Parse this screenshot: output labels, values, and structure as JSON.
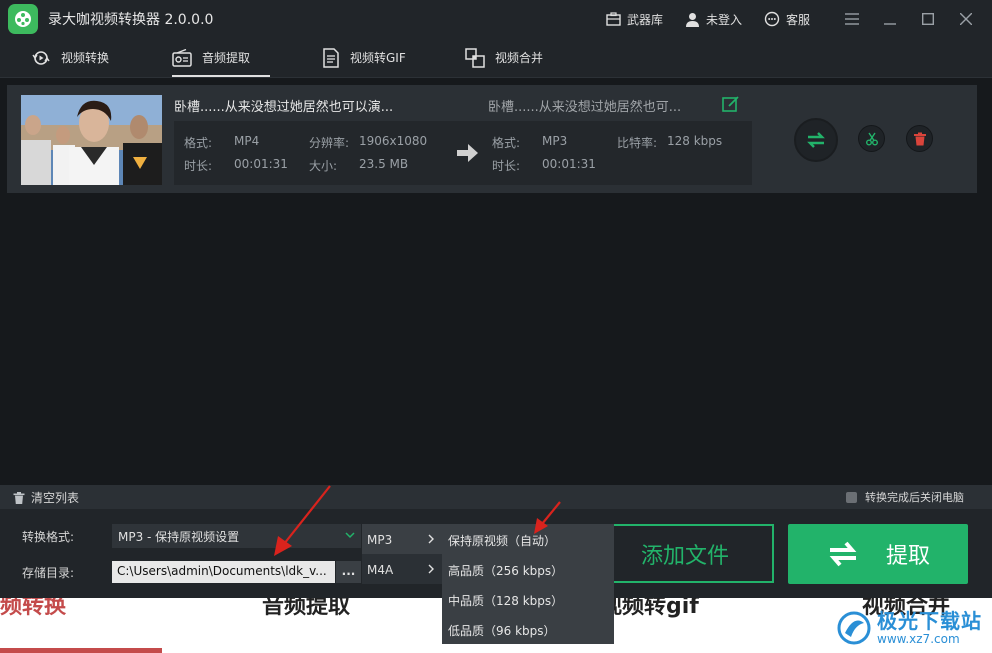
{
  "app": {
    "title": "录大咖视频转换器 2.0.0.0",
    "header_links": [
      {
        "label": "武器库",
        "icon": "toolbox-icon"
      },
      {
        "label": "未登入",
        "icon": "user-icon"
      },
      {
        "label": "客服",
        "icon": "chat-icon"
      }
    ]
  },
  "nav": {
    "tabs": [
      {
        "label": "视频转换",
        "icon": "convert-icon",
        "active": false
      },
      {
        "label": "音频提取",
        "icon": "radio-icon",
        "active": true
      },
      {
        "label": "视频转GIF",
        "icon": "gif-doc-icon",
        "active": false
      },
      {
        "label": "视频合并",
        "icon": "merge-icon",
        "active": false
      }
    ]
  },
  "file": {
    "source_name": "卧槽......从来没想过她居然也可以演...",
    "output_name": "卧槽......从来没想过她居然也可...",
    "source": {
      "format_label": "格式:",
      "format": "MP4",
      "resolution_label": "分辨率:",
      "resolution": "1906x1080",
      "duration_label": "时长:",
      "duration": "00:01:31",
      "size_label": "大小:",
      "size": "23.5 MB"
    },
    "output": {
      "format_label": "格式:",
      "format": "MP3",
      "bitrate_label": "比特率:",
      "bitrate": "128 kbps",
      "duration_label": "时长:",
      "duration": "00:01:31"
    }
  },
  "bottom": {
    "clear_list": "清空列表",
    "shutdown_option": "转换完成后关闭电脑",
    "format_label": "转换格式:",
    "format_value": "MP3 - 保持原视频设置",
    "dir_label": "存储目录:",
    "dir_value": "C:\\Users\\admin\\Documents\\ldk_v...",
    "browse": "...",
    "add_file": "添加文件",
    "extract": "提取"
  },
  "dropdown": {
    "formats": [
      "MP3",
      "M4A"
    ],
    "qualities": [
      "保持原视频（自动）",
      "高品质（256 kbps）",
      "中品质（128 kbps）",
      "低品质（96 kbps）"
    ]
  },
  "background": {
    "words": [
      "频转换",
      "音频提取",
      "视频转gif",
      "视频合并"
    ]
  },
  "watermark": {
    "name": "极光下载站",
    "url": "www.xz7.com"
  },
  "colors": {
    "accent_green": "#22b36a",
    "delete_red": "#d9443b",
    "window_bg": "#16191c",
    "panel_bg": "#2b3035"
  }
}
